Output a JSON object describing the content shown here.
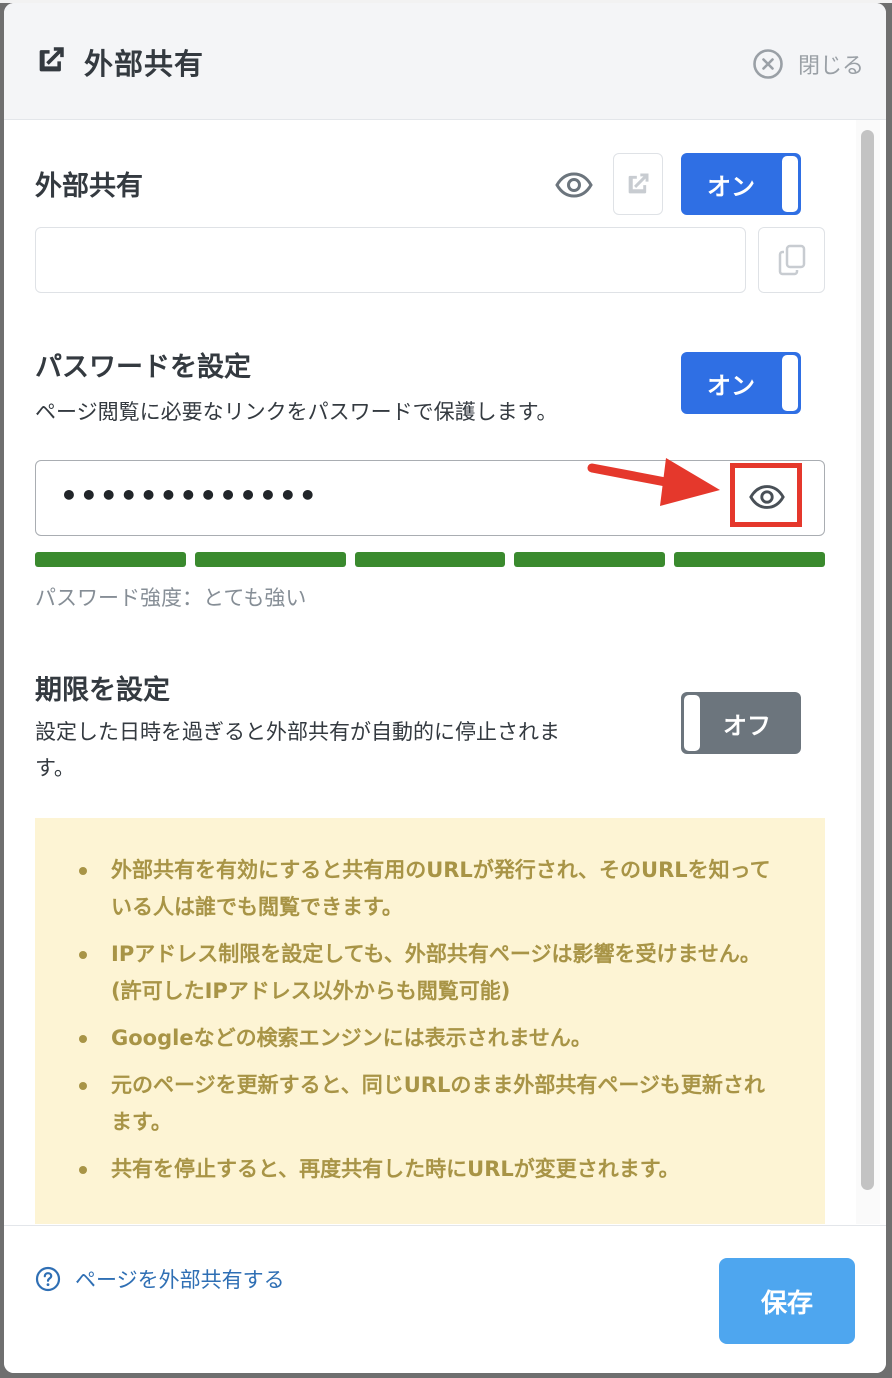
{
  "dialog": {
    "title": "外部共有",
    "close_label": "閉じる"
  },
  "share": {
    "title": "外部共有",
    "toggle_label": "オン",
    "url_value": ""
  },
  "password": {
    "title": "パスワードを設定",
    "description": "ページ閲覧に必要なリンクをパスワードで保護します。",
    "toggle_label": "オン",
    "masked_value": "•••••••••••••",
    "strength_segments": 5,
    "strength_label": "パスワード強度：とても強い"
  },
  "expiry": {
    "title": "期限を設定",
    "description_line1": "設定した日時を過ぎると外部共有が自動的に停止されま",
    "description_line2": "す。",
    "toggle_label": "オフ"
  },
  "notice": {
    "items": [
      "外部共有を有効にすると共有用のURLが発行され、そのURLを知っている人は誰でも閲覧できます。",
      "IPアドレス制限を設定しても、外部共有ページは影響を受けません。(許可したIPアドレス以外からも閲覧可能)",
      "Googleなどの検索エンジンには表示されません。",
      "元のページを更新すると、同じURLのまま外部共有ページも更新されます。",
      "共有を停止すると、再度共有した時にURLが変更されます。"
    ]
  },
  "footer": {
    "help_label": "ページを外部共有する",
    "save_label": "保存"
  },
  "colors": {
    "primary": "#2f6fe4",
    "toggle_off": "#6c757d",
    "strength": "#3a8a2e",
    "notice_bg": "#fdf4d4",
    "notice_text": "#a89446",
    "save": "#4ea6ef",
    "highlight": "#e5382c"
  }
}
